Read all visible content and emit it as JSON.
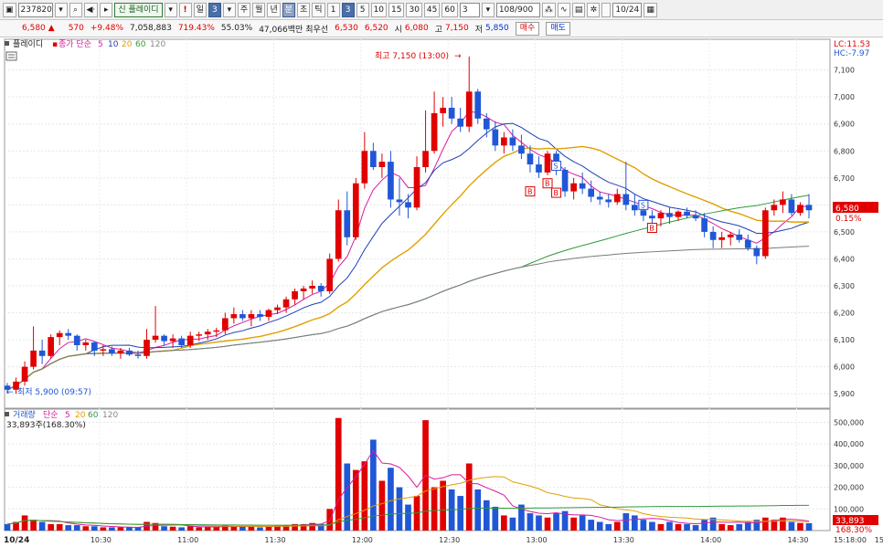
{
  "toolbar": {
    "code": "237820",
    "name_badge": "신",
    "name": "플레이디",
    "period_value": "3",
    "period_tabs": [
      "일",
      "3",
      "주",
      "월",
      "년",
      "분",
      "초",
      "틱"
    ],
    "interval_tabs": [
      "1",
      "3",
      "5",
      "10",
      "15",
      "30",
      "45",
      "60"
    ],
    "count_value": "3",
    "range": "108/900",
    "date": "10/24"
  },
  "quote": {
    "price": "6,580",
    "change": "570",
    "change_pct": "+9.48%",
    "volume": "7,058,883",
    "vol_ratio": "719.43%",
    "turnover": "55.03%",
    "amount": "47,066백만",
    "prev_label": "최우선",
    "prev_a": "6,530",
    "prev_b": "6,520",
    "open_label": "시",
    "open": "6,080",
    "high_label": "고",
    "high": "7,150",
    "low_label": "저",
    "low": "5,850",
    "buy_label": "매수",
    "sell_label": "매도"
  },
  "price_panel": {
    "legend_name": "플레이디",
    "legend_ma_label": "종가 단순",
    "legend_ma_periods": [
      "5",
      "10",
      "20",
      "60",
      "120"
    ],
    "lc": "LC:11.53",
    "hc": "HC:-7.97",
    "current_tag": "6,580",
    "current_pct": "0.15%",
    "high_annotation": "최고 7,150 (13:00)",
    "low_annotation": "최저 5,900 (09:57)",
    "signal_b": "B",
    "signal_s": "S"
  },
  "volume_panel": {
    "legend_name": "거래량",
    "legend_ma_label": "단순",
    "legend_ma_periods": [
      "5",
      "20",
      "60",
      "120"
    ],
    "current_text": "33,893주(168.30%)",
    "current_tag": "33,893",
    "current_pct": "168.30%"
  },
  "colors": {
    "up": "#e00000",
    "down": "#1f57d6",
    "ma5": "#d81ba0",
    "ma10": "#1f3fb5",
    "ma20": "#e0a000",
    "ma60": "#2e9a3a",
    "ma120": "#7a7a7a"
  },
  "chart_data": {
    "type": "candlestick",
    "unit": "KRW",
    "interval": "3 minutes",
    "date": "10/24",
    "x_tick_labels": [
      "10:30",
      "11:00",
      "11:30",
      "12:00",
      "12:30",
      "13:00",
      "13:30",
      "14:00",
      "14:30",
      "15:00",
      "15:18:00"
    ],
    "price_ticks": [
      5900,
      6000,
      6100,
      6200,
      6300,
      6400,
      6500,
      6600,
      6700,
      6800,
      6900,
      7000,
      7100
    ],
    "price_tick_labels": [
      "5,900",
      "6,000",
      "6,100",
      "6,200",
      "6,300",
      "6,400",
      "6,500",
      "6,600",
      "6,700",
      "6,800",
      "6,900",
      "7,000",
      "7,100"
    ],
    "volume_ticks": [
      100000,
      200000,
      300000,
      400000,
      500000
    ],
    "volume_tick_labels": [
      "100,000",
      "200,000",
      "300,000",
      "400,000",
      "500,000"
    ],
    "price_range": [
      5860,
      7180
    ],
    "volume_range": [
      0,
      540000
    ],
    "candles": [
      [
        5930,
        5940,
        5900,
        5915,
        30000
      ],
      [
        5915,
        5960,
        5900,
        5945,
        40000
      ],
      [
        5945,
        6020,
        5930,
        6000,
        70000
      ],
      [
        6000,
        6150,
        5990,
        6060,
        50000
      ],
      [
        6060,
        6100,
        6010,
        6040,
        40000
      ],
      [
        6040,
        6120,
        6030,
        6110,
        30000
      ],
      [
        6110,
        6135,
        6080,
        6125,
        30000
      ],
      [
        6125,
        6140,
        6100,
        6115,
        25000
      ],
      [
        6115,
        6120,
        6060,
        6080,
        25000
      ],
      [
        6080,
        6100,
        6060,
        6090,
        20000
      ],
      [
        6090,
        6095,
        6040,
        6060,
        20000
      ],
      [
        6060,
        6080,
        6040,
        6065,
        15000
      ],
      [
        6065,
        6075,
        6040,
        6050,
        15000
      ],
      [
        6050,
        6070,
        6030,
        6060,
        15000
      ],
      [
        6060,
        6070,
        6040,
        6045,
        15000
      ],
      [
        6045,
        6060,
        6030,
        6040,
        15000
      ],
      [
        6040,
        6140,
        6030,
        6100,
        40000
      ],
      [
        6100,
        6225,
        6090,
        6115,
        35000
      ],
      [
        6115,
        6120,
        6080,
        6095,
        20000
      ],
      [
        6095,
        6120,
        6070,
        6105,
        18000
      ],
      [
        6105,
        6115,
        6070,
        6080,
        15000
      ],
      [
        6080,
        6130,
        6070,
        6115,
        20000
      ],
      [
        6115,
        6130,
        6095,
        6120,
        15000
      ],
      [
        6120,
        6140,
        6100,
        6130,
        18000
      ],
      [
        6130,
        6145,
        6110,
        6135,
        15000
      ],
      [
        6135,
        6200,
        6120,
        6180,
        25000
      ],
      [
        6180,
        6220,
        6160,
        6195,
        20000
      ],
      [
        6195,
        6210,
        6170,
        6180,
        18000
      ],
      [
        6180,
        6210,
        6150,
        6195,
        20000
      ],
      [
        6195,
        6210,
        6170,
        6185,
        15000
      ],
      [
        6185,
        6215,
        6170,
        6210,
        20000
      ],
      [
        6210,
        6230,
        6195,
        6220,
        22000
      ],
      [
        6220,
        6260,
        6200,
        6250,
        25000
      ],
      [
        6250,
        6290,
        6230,
        6280,
        30000
      ],
      [
        6280,
        6300,
        6250,
        6290,
        30000
      ],
      [
        6290,
        6320,
        6270,
        6300,
        35000
      ],
      [
        6300,
        6310,
        6260,
        6280,
        30000
      ],
      [
        6280,
        6420,
        6270,
        6400,
        100000
      ],
      [
        6400,
        6620,
        6390,
        6580,
        520000
      ],
      [
        6580,
        6650,
        6450,
        6480,
        310000
      ],
      [
        6480,
        6700,
        6470,
        6680,
        280000
      ],
      [
        6680,
        6870,
        6660,
        6800,
        320000
      ],
      [
        6800,
        6830,
        6730,
        6740,
        420000
      ],
      [
        6740,
        6790,
        6700,
        6760,
        230000
      ],
      [
        6760,
        6800,
        6590,
        6620,
        290000
      ],
      [
        6620,
        6700,
        6560,
        6610,
        200000
      ],
      [
        6610,
        6640,
        6550,
        6590,
        120000
      ],
      [
        6590,
        6780,
        6580,
        6740,
        160000
      ],
      [
        6740,
        6950,
        6720,
        6800,
        510000
      ],
      [
        6800,
        7020,
        6790,
        6940,
        200000
      ],
      [
        6940,
        7000,
        6890,
        6960,
        230000
      ],
      [
        6960,
        7000,
        6900,
        6920,
        190000
      ],
      [
        6920,
        6960,
        6870,
        6890,
        160000
      ],
      [
        6890,
        7150,
        6870,
        7020,
        310000
      ],
      [
        7020,
        7030,
        6900,
        6920,
        190000
      ],
      [
        6920,
        6940,
        6850,
        6880,
        140000
      ],
      [
        6880,
        6910,
        6800,
        6820,
        110000
      ],
      [
        6820,
        6870,
        6790,
        6850,
        70000
      ],
      [
        6850,
        6880,
        6800,
        6820,
        60000
      ],
      [
        6820,
        6860,
        6770,
        6790,
        120000
      ],
      [
        6790,
        6820,
        6720,
        6750,
        80000
      ],
      [
        6750,
        6780,
        6700,
        6720,
        70000
      ],
      [
        6720,
        6800,
        6710,
        6790,
        60000
      ],
      [
        6790,
        6800,
        6710,
        6730,
        80000
      ],
      [
        6730,
        6740,
        6630,
        6650,
        90000
      ],
      [
        6650,
        6700,
        6620,
        6680,
        60000
      ],
      [
        6680,
        6720,
        6640,
        6660,
        70000
      ],
      [
        6660,
        6690,
        6610,
        6630,
        50000
      ],
      [
        6630,
        6650,
        6600,
        6620,
        40000
      ],
      [
        6620,
        6640,
        6590,
        6610,
        30000
      ],
      [
        6610,
        6660,
        6600,
        6640,
        40000
      ],
      [
        6640,
        6760,
        6580,
        6600,
        80000
      ],
      [
        6600,
        6640,
        6560,
        6580,
        70000
      ],
      [
        6580,
        6600,
        6540,
        6560,
        50000
      ],
      [
        6560,
        6580,
        6530,
        6550,
        40000
      ],
      [
        6550,
        6580,
        6520,
        6570,
        30000
      ],
      [
        6570,
        6590,
        6530,
        6555,
        40000
      ],
      [
        6555,
        6580,
        6540,
        6575,
        30000
      ],
      [
        6575,
        6590,
        6550,
        6560,
        30000
      ],
      [
        6560,
        6580,
        6540,
        6550,
        25000
      ],
      [
        6550,
        6570,
        6480,
        6500,
        50000
      ],
      [
        6500,
        6520,
        6440,
        6470,
        60000
      ],
      [
        6470,
        6500,
        6440,
        6480,
        30000
      ],
      [
        6480,
        6500,
        6450,
        6490,
        25000
      ],
      [
        6490,
        6510,
        6460,
        6470,
        30000
      ],
      [
        6470,
        6490,
        6430,
        6440,
        40000
      ],
      [
        6440,
        6450,
        6380,
        6410,
        50000
      ],
      [
        6410,
        6590,
        6400,
        6580,
        60000
      ],
      [
        6580,
        6620,
        6560,
        6600,
        50000
      ],
      [
        6600,
        6650,
        6570,
        6620,
        60000
      ],
      [
        6620,
        6640,
        6560,
        6570,
        40000
      ],
      [
        6570,
        6610,
        6560,
        6600,
        35000
      ],
      [
        6600,
        6640,
        6550,
        6580,
        33893
      ]
    ],
    "markers": {
      "B": [
        [
          60,
          6650
        ],
        [
          62,
          6680
        ],
        [
          63,
          6645
        ],
        [
          74,
          6515
        ]
      ],
      "S": [
        [
          63,
          6745
        ],
        [
          73,
          6600
        ]
      ]
    },
    "high": {
      "label": "최고 7,150 (13:00)",
      "index": 53,
      "price": 7150
    },
    "low": {
      "label": "최저 5,900 (09:57)",
      "index": 1,
      "price": 5900
    }
  }
}
